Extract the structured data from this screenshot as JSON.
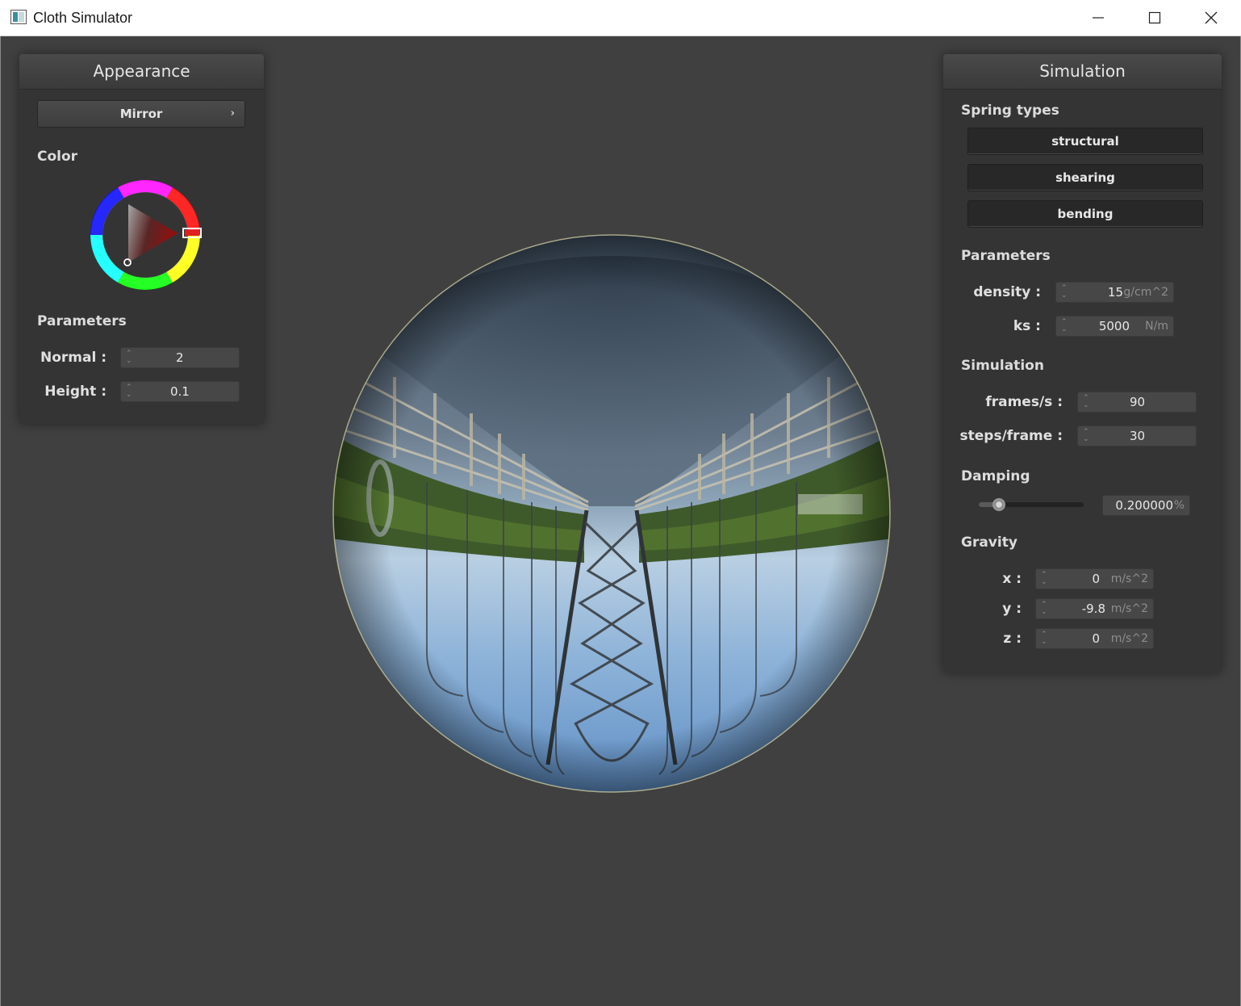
{
  "window": {
    "title": "Cloth Simulator",
    "controls": [
      "minimize-icon",
      "maximize-icon",
      "close-icon"
    ]
  },
  "appearance": {
    "header": "Appearance",
    "shader": "Mirror",
    "shader_arrow": "›",
    "color_label": "Color",
    "color_value": "#e02020",
    "parameters_label": "Parameters",
    "normal": {
      "label": "Normal :",
      "value": "2"
    },
    "height": {
      "label": "Height :",
      "value": "0.1"
    }
  },
  "simulation": {
    "header": "Simulation",
    "spring_types_label": "Spring types",
    "springs": [
      "structural",
      "shearing",
      "bending"
    ],
    "parameters_label": "Parameters",
    "density": {
      "label": "density :",
      "value": "15",
      "unit": "g/cm^2"
    },
    "ks": {
      "label": "ks :",
      "value": "5000",
      "unit": "N/m"
    },
    "simulation_label": "Simulation",
    "fps": {
      "label": "frames/s :",
      "value": "90"
    },
    "steps": {
      "label": "steps/frame :",
      "value": "30"
    },
    "damping_label": "Damping",
    "damping": {
      "value": "0.200000",
      "unit": "%",
      "slider_fraction": 0.2
    },
    "gravity_label": "Gravity",
    "gx": {
      "label": "x :",
      "value": "0",
      "unit": "m/s^2"
    },
    "gy": {
      "label": "y :",
      "value": "-9.8",
      "unit": "m/s^2"
    },
    "gz": {
      "label": "z :",
      "value": "0",
      "unit": "m/s^2"
    }
  }
}
